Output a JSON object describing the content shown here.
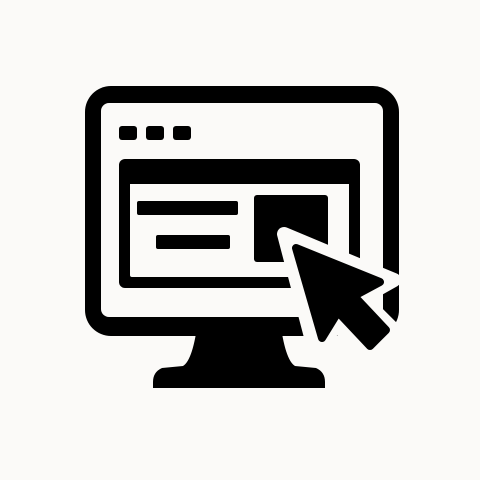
{
  "icon": {
    "name": "computer-monitor-with-cursor-icon",
    "background_color": "#fbfaf8",
    "foreground_color": "#000000",
    "parts": [
      "monitor-frame-icon",
      "monitor-screen-icon",
      "window-dots-icon",
      "browser-window-icon",
      "content-lines-icon",
      "content-block-icon",
      "mouse-cursor-icon",
      "monitor-stand-icon"
    ]
  }
}
